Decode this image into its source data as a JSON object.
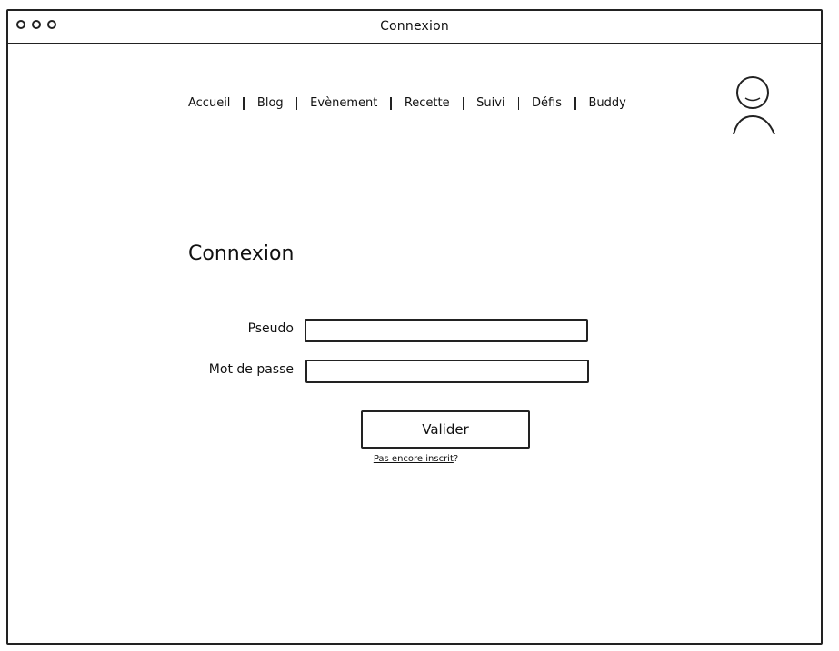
{
  "window": {
    "title": "Connexion"
  },
  "nav": {
    "items": [
      {
        "label": "Accueil"
      },
      {
        "label": "Blog"
      },
      {
        "label": "Evènement"
      },
      {
        "label": "Recette"
      },
      {
        "label": "Suivi"
      },
      {
        "label": "Défis"
      },
      {
        "label": "Buddy"
      }
    ]
  },
  "header": {
    "avatar_icon": "user-avatar-icon"
  },
  "main": {
    "title": "Connexion",
    "form": {
      "pseudo_label": "Pseudo",
      "pseudo_value": "",
      "password_label": "Mot de passe",
      "password_value": "",
      "submit_label": "Valider",
      "register_link_text": "Pas encore inscrit",
      "register_suffix": "?"
    }
  }
}
